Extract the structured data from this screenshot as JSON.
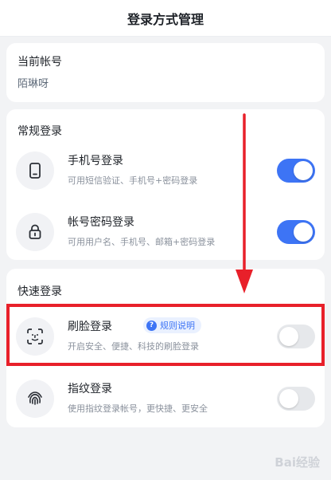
{
  "header": {
    "title": "登录方式管理"
  },
  "account": {
    "section_title": "当前帐号",
    "name": "陌琳呀"
  },
  "normal": {
    "section_title": "常规登录",
    "items": [
      {
        "title": "手机号登录",
        "subtitle": "可用短信验证、手机号+密码登录",
        "icon": "phone-icon",
        "enabled": true
      },
      {
        "title": "帐号密码登录",
        "subtitle": "可用用户名、手机号、邮箱+密码登录",
        "icon": "lock-icon",
        "enabled": true
      }
    ]
  },
  "quick": {
    "section_title": "快速登录",
    "items": [
      {
        "title": "刷脸登录",
        "badge": "规则说明",
        "subtitle": "开启安全、便捷、科技的刷脸登录",
        "icon": "face-scan-icon",
        "enabled": false
      },
      {
        "title": "指纹登录",
        "subtitle": "使用指纹登录帐号，更快捷、更安全",
        "icon": "fingerprint-icon",
        "enabled": false
      }
    ]
  },
  "colors": {
    "accent": "#3d74f5",
    "annotation": "#e8202a",
    "toggle_off": "#e6e8eb"
  },
  "watermark": "Bai经验"
}
